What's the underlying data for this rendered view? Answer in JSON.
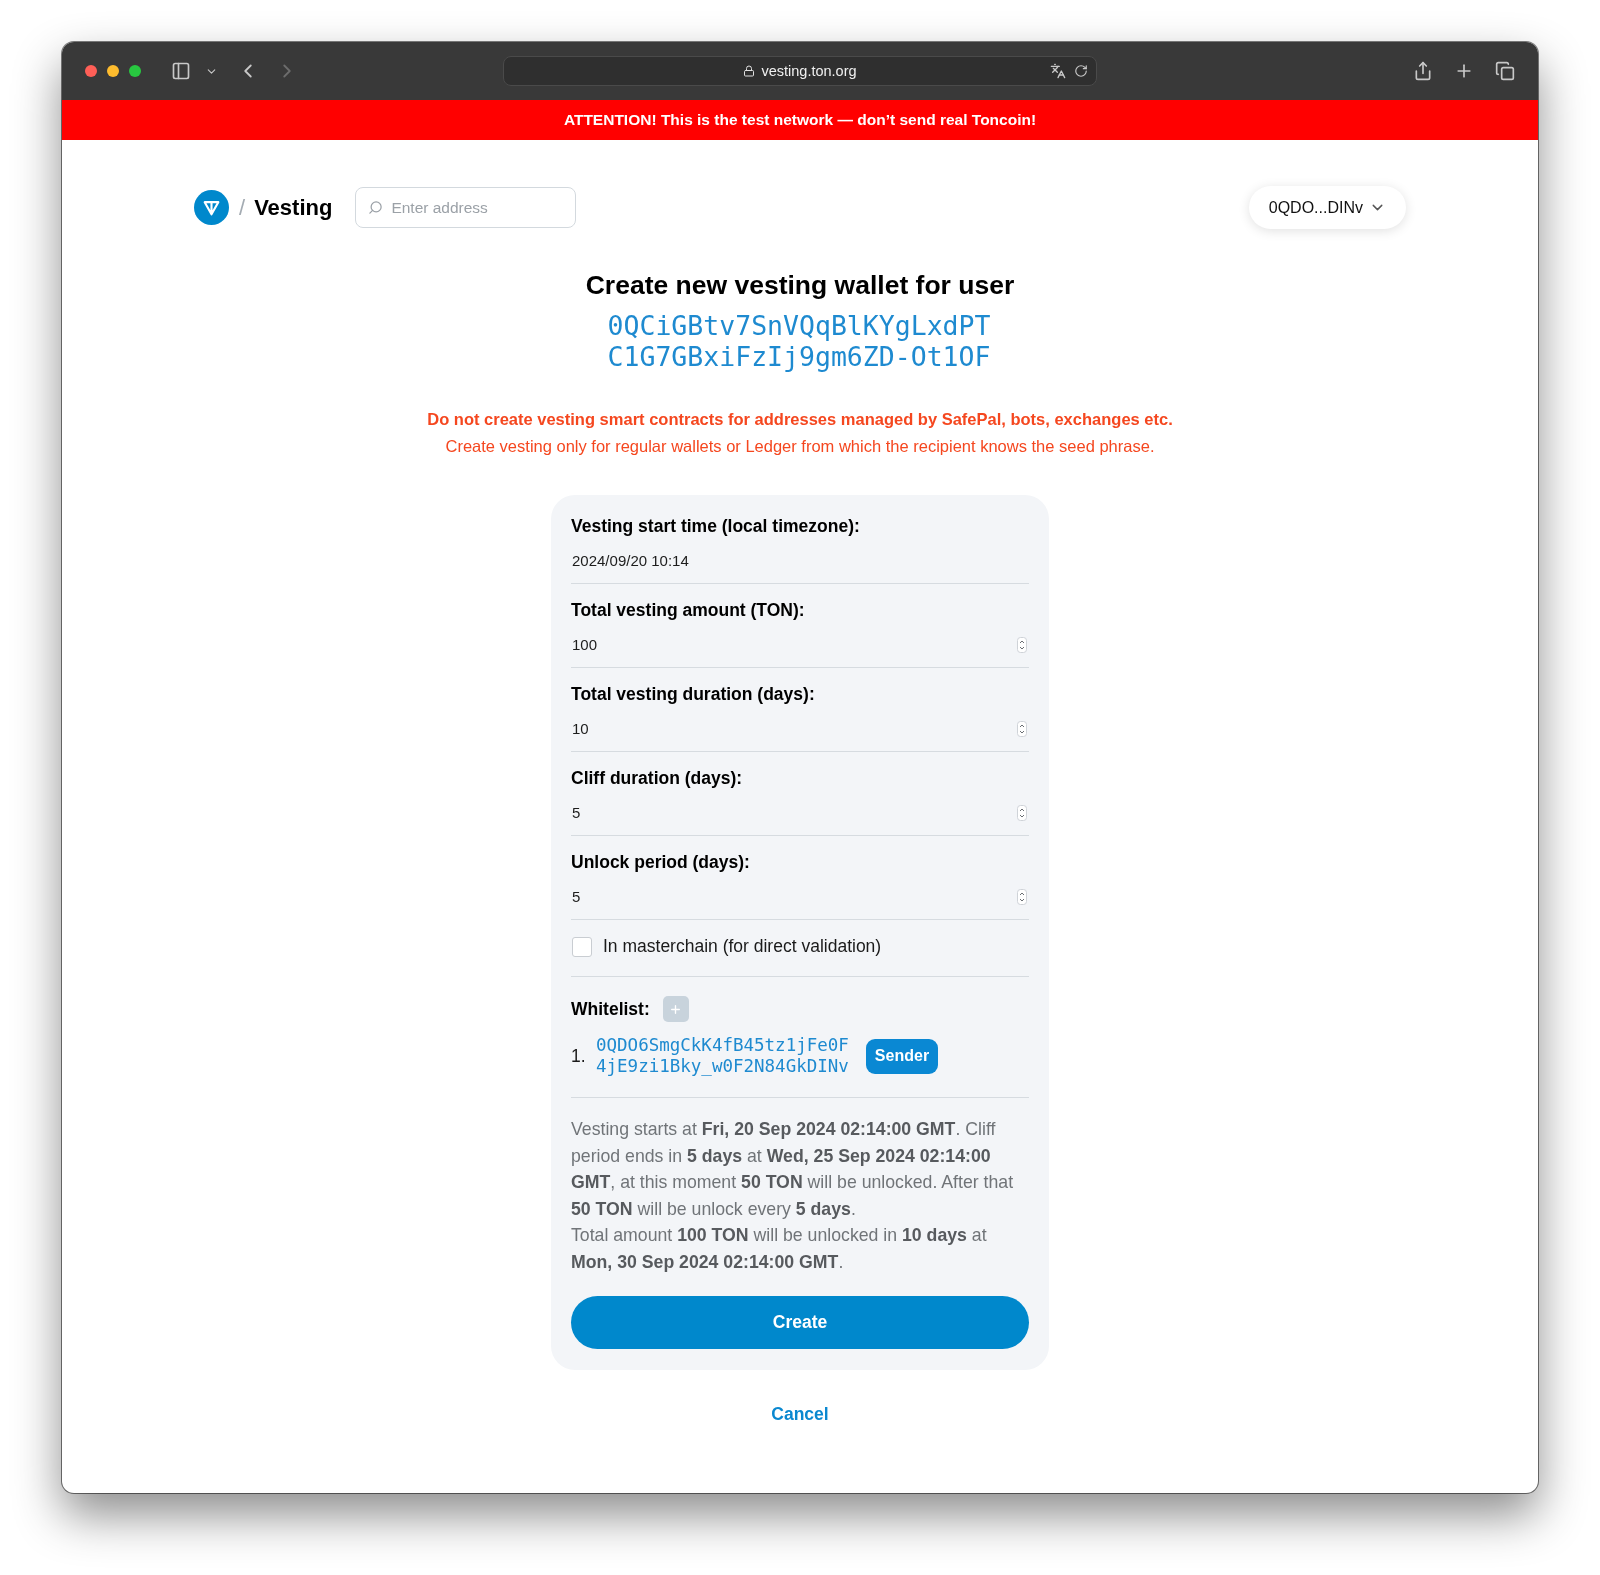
{
  "browser": {
    "url": "vesting.ton.org",
    "back_disabled": false,
    "forward_disabled": true
  },
  "banner": {
    "text": "ATTENTION! This is the test network — don’t send real Toncoin!"
  },
  "header": {
    "separator": "/",
    "app_name": "Vesting",
    "search": {
      "placeholder": "Enter address"
    },
    "wallet": {
      "label": "0QDO...DINv"
    }
  },
  "title": "Create new vesting wallet for user",
  "recipient_address": "0QCiGBtv7SnVQqBlKYgLxdPTC1G7GBxiFzIj9gm6ZD-Ot1OF",
  "warnings": [
    {
      "kind": "strong",
      "text": "Do not create vesting smart contracts for addresses managed by SafePal, bots, exchanges etc."
    },
    {
      "kind": "plain",
      "text": "Create vesting only for regular wallets or Ledger from which the recipient knows the seed phrase."
    }
  ],
  "form": {
    "fields": [
      {
        "kind": "datetime",
        "label": "Vesting start time (local timezone):",
        "value": "2024/09/20 10:14"
      },
      {
        "kind": "number",
        "label": "Total vesting amount (TON):",
        "value": "100"
      },
      {
        "kind": "number",
        "label": "Total vesting duration (days):",
        "value": "10"
      },
      {
        "kind": "number",
        "label": "Cliff duration (days):",
        "value": "5"
      },
      {
        "kind": "number",
        "label": "Unlock period (days):",
        "value": "5"
      }
    ],
    "masterchain": {
      "label": "In masterchain (for direct validation)",
      "checked": false
    },
    "whitelist": {
      "label": "Whitelist:",
      "items": [
        {
          "number": "1.",
          "address": "0QDO6SmgCkK4fB45tz1jFe0F4jE9zi1Bky_w0F2N84GkDINv",
          "tag": "Sender"
        }
      ]
    },
    "summary": [
      "Vesting starts at **Fri, 20 Sep 2024 02:14:00 GMT**. Cliff period ends in **5 days** at **Wed, 25 Sep 2024 02:14:00 GMT**, at this moment **50 TON** will be unlocked. After that **50 TON** will be unlock every **5 days**.",
      "Total amount **100 TON** will be unlocked in **10 days** at **Mon, 30 Sep 2024 02:14:00 GMT**."
    ],
    "submit": "Create"
  },
  "cancel": "Cancel"
}
